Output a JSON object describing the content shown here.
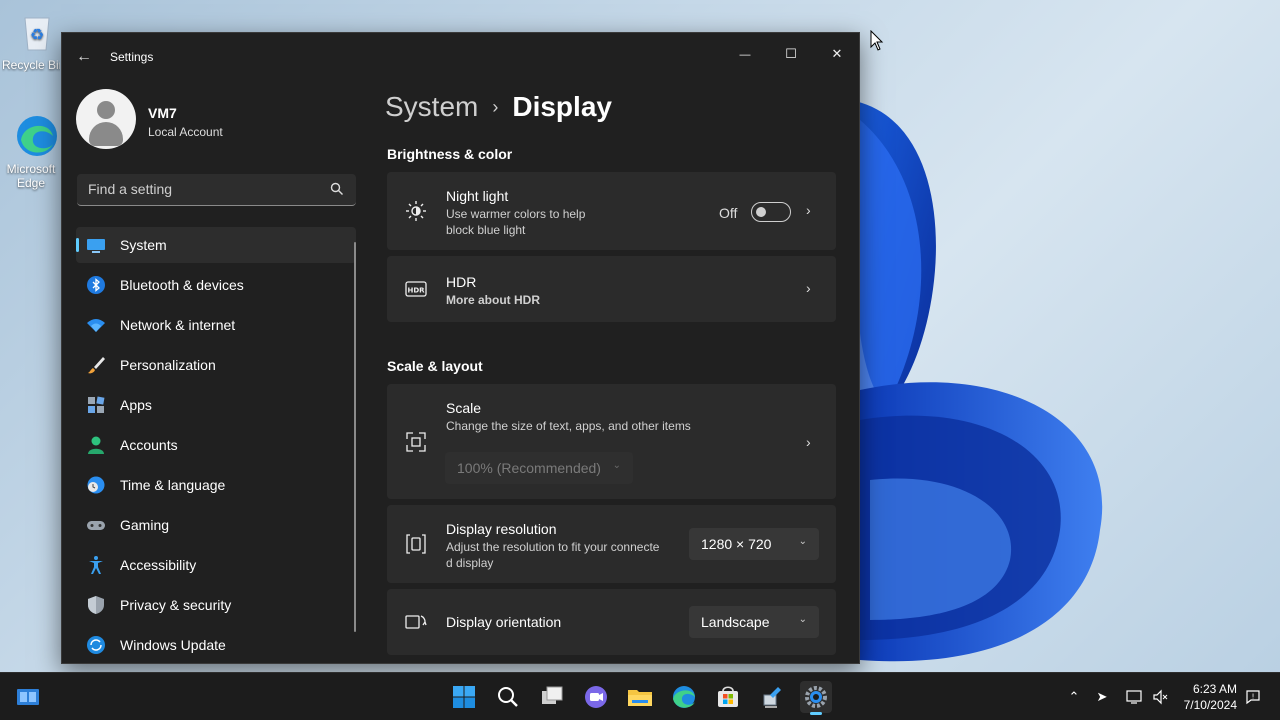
{
  "desktop": {
    "icons": [
      {
        "label": "Recycle Bin",
        "icon": "recycle-bin-icon"
      },
      {
        "label": "Microsoft Edge",
        "icon": "edge-icon"
      }
    ]
  },
  "window": {
    "title": "Settings",
    "controls": {
      "minimize": "—",
      "maximize": "☐",
      "close": "✕"
    }
  },
  "user": {
    "name": "VM7",
    "account_type": "Local Account"
  },
  "search": {
    "placeholder": "Find a setting"
  },
  "nav": {
    "items": [
      {
        "label": "System",
        "icon": "system-icon",
        "active": true
      },
      {
        "label": "Bluetooth & devices",
        "icon": "bluetooth-icon"
      },
      {
        "label": "Network & internet",
        "icon": "wifi-icon"
      },
      {
        "label": "Personalization",
        "icon": "brush-icon"
      },
      {
        "label": "Apps",
        "icon": "apps-icon"
      },
      {
        "label": "Accounts",
        "icon": "accounts-icon"
      },
      {
        "label": "Time & language",
        "icon": "globe-clock-icon"
      },
      {
        "label": "Gaming",
        "icon": "gamepad-icon"
      },
      {
        "label": "Accessibility",
        "icon": "accessibility-icon"
      },
      {
        "label": "Privacy & security",
        "icon": "shield-icon"
      },
      {
        "label": "Windows Update",
        "icon": "update-icon"
      }
    ]
  },
  "breadcrumb": {
    "parent": "System",
    "separator": "›",
    "current": "Display"
  },
  "sections": {
    "brightness": {
      "title": "Brightness & color",
      "night_light": {
        "title": "Night light",
        "subtitle_line1": "Use warmer colors to help",
        "subtitle_line2": "block blue light",
        "toggle_label": "Off",
        "toggle_on": false
      },
      "hdr": {
        "title": "HDR",
        "link": "More about HDR"
      }
    },
    "scale_layout": {
      "title": "Scale & layout",
      "scale": {
        "title": "Scale",
        "subtitle": "Change the size of text, apps, and other items",
        "value": "100% (Recommended)"
      },
      "resolution": {
        "title": "Display resolution",
        "subtitle_line1": "Adjust the resolution to fit your connecte",
        "subtitle_line2": "d display",
        "value": "1280 × 720"
      },
      "orientation": {
        "title": "Display orientation",
        "value": "Landscape"
      }
    }
  },
  "taskbar": {
    "clock_time": "6:23 AM",
    "clock_date": "7/10/2024",
    "apps": [
      "start-icon",
      "search-icon",
      "task-view-icon",
      "chat-icon",
      "file-explorer-icon",
      "edge-icon",
      "store-icon",
      "network-tool-icon",
      "settings-icon"
    ]
  },
  "colors": {
    "accent": "#60cdff",
    "window_bg": "#202020",
    "card_bg": "#2b2b2b",
    "link": "#99ebff"
  }
}
